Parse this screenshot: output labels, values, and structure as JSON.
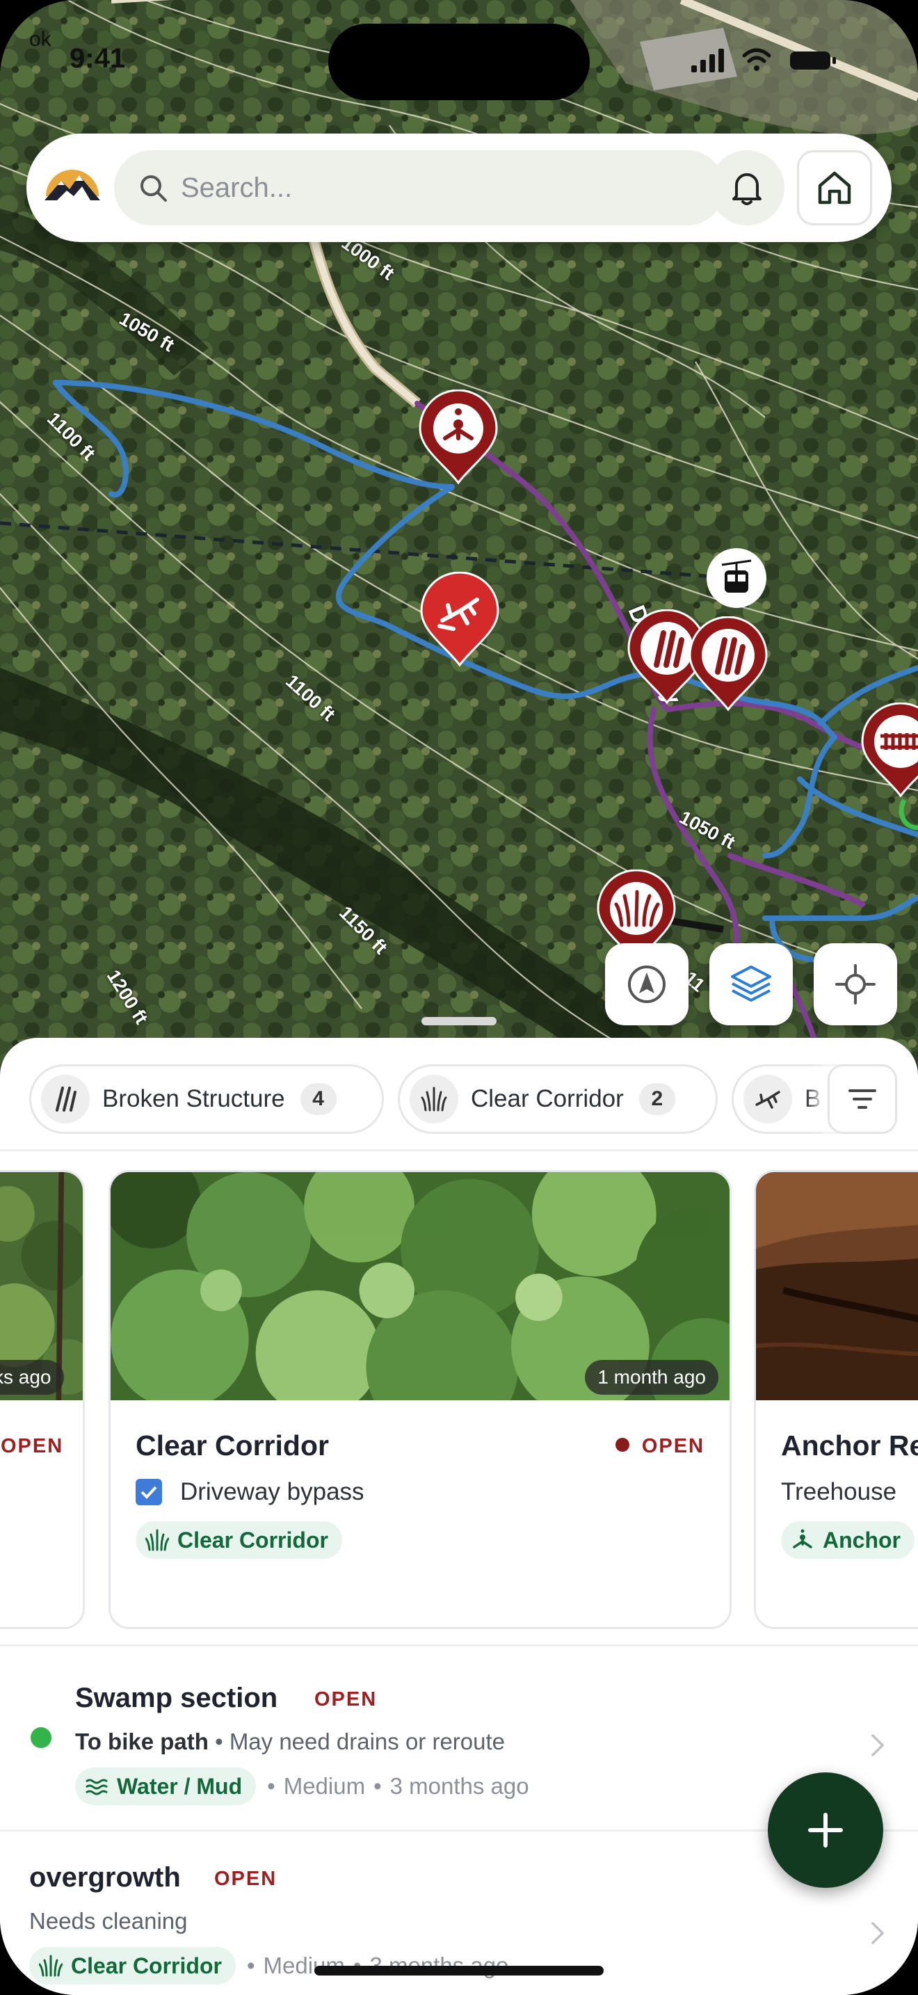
{
  "status_bar": {
    "time": "9:41",
    "back_label": "ok"
  },
  "search": {
    "placeholder": "Search..."
  },
  "map": {
    "contour_labels": [
      "1000 ft",
      "1050 ft",
      "1100 ft",
      "1100 ft",
      "1050 ft",
      "1150 ft",
      "1200 ft"
    ],
    "road_label": "Driveway",
    "partial_label": "11"
  },
  "categories": [
    {
      "label": "Broken Structure",
      "count": "4",
      "icon": "broken-structure-icon"
    },
    {
      "label": "Clear Corridor",
      "count": "2",
      "icon": "clear-corridor-icon"
    },
    {
      "label": "B",
      "count": "",
      "icon": "fallen-tree-icon"
    }
  ],
  "cards": [
    {
      "time": "ks ago",
      "status": "OPEN"
    },
    {
      "time": "1 month ago",
      "title": "Clear Corridor",
      "status": "OPEN",
      "subtitle": "Driveway bypass",
      "tag": "Clear Corridor"
    },
    {
      "title": "Anchor Re",
      "subtitle": "Treehouse",
      "tag": "Anchor"
    }
  ],
  "list": [
    {
      "title": "Swamp section",
      "status": "OPEN",
      "location": "To bike path",
      "note": "May need drains or reroute",
      "tag": "Water / Mud",
      "severity": "Medium",
      "age": "3 months ago",
      "sep": "•"
    },
    {
      "title": "overgrowth",
      "status": "OPEN",
      "note": "Needs cleaning",
      "tag": "Clear Corridor",
      "severity": "Medium",
      "age": "3 months ago",
      "sep": "•"
    }
  ],
  "colors": {
    "accent_dark_green": "#123a20",
    "status_red": "#a11e1e",
    "pin_red": "#8f1717",
    "tag_green_bg": "#e8f5ee",
    "tag_green_text": "#12683a",
    "trail_blue": "#3a7fc4",
    "trail_purple": "#7e3f92"
  }
}
